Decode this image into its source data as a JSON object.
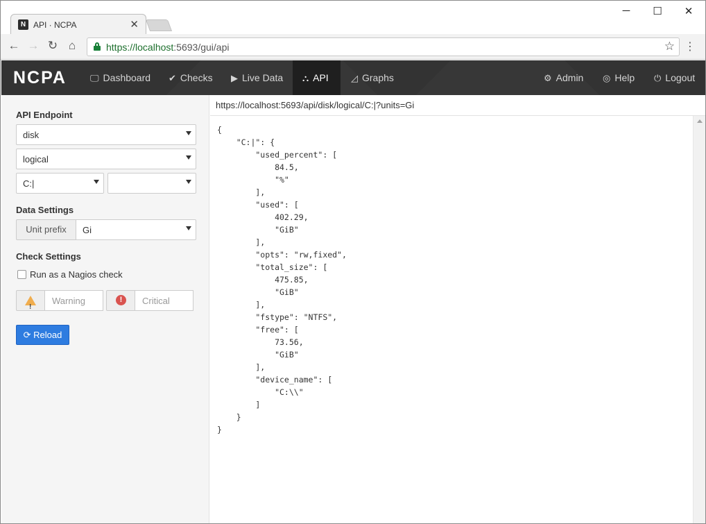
{
  "browser": {
    "tab_title": "API · NCPA",
    "tab_favicon": "N",
    "url_host": "https://localhost",
    "url_rest": ":5693/gui/api",
    "controls": {
      "minimize": "─",
      "maximize": "☐",
      "close": "✕",
      "tab_close": "✕"
    }
  },
  "navbar": {
    "brand": "NCPA",
    "items": [
      {
        "label": "Dashboard",
        "icon": "monitor-icon"
      },
      {
        "label": "Checks",
        "icon": "check-icon"
      },
      {
        "label": "Live Data",
        "icon": "play-icon"
      },
      {
        "label": "API",
        "icon": "sitemap-icon"
      },
      {
        "label": "Graphs",
        "icon": "area-chart-icon"
      }
    ],
    "right_items": [
      {
        "label": "Admin",
        "icon": "gear-icon"
      },
      {
        "label": "Help",
        "icon": "life-ring-icon"
      },
      {
        "label": "Logout",
        "icon": "power-icon"
      }
    ],
    "active": "API"
  },
  "sidebar": {
    "api_endpoint_heading": "API Endpoint",
    "endpoint_select": "disk",
    "sub_select": "logical",
    "drive_select": "C:|",
    "extra_select": "",
    "data_settings_heading": "Data Settings",
    "unit_prefix_label": "Unit prefix",
    "unit_prefix_value": "Gi",
    "check_settings_heading": "Check Settings",
    "nagios_check_label": "Run as a Nagios check",
    "warning_placeholder": "Warning",
    "critical_placeholder": "Critical",
    "reload_label": "Reload"
  },
  "main": {
    "api_url": "https://localhost:5693/api/disk/logical/C:|?units=Gi",
    "json_output": "{\n    \"C:|\": {\n        \"used_percent\": [\n            84.5,\n            \"%\"\n        ],\n        \"used\": [\n            402.29,\n            \"GiB\"\n        ],\n        \"opts\": \"rw,fixed\",\n        \"total_size\": [\n            475.85,\n            \"GiB\"\n        ],\n        \"fstype\": \"NTFS\",\n        \"free\": [\n            73.56,\n            \"GiB\"\n        ],\n        \"device_name\": [\n            \"C:\\\\\"\n        ]\n    }\n}"
  },
  "colors": {
    "navbar_bg": "#333333",
    "navbar_active_bg": "#1f1f1f",
    "reload_button": "#2e7ce0",
    "warning": "#f0ad4e",
    "critical": "#d9534f",
    "secure_url": "#1d6f2d"
  }
}
